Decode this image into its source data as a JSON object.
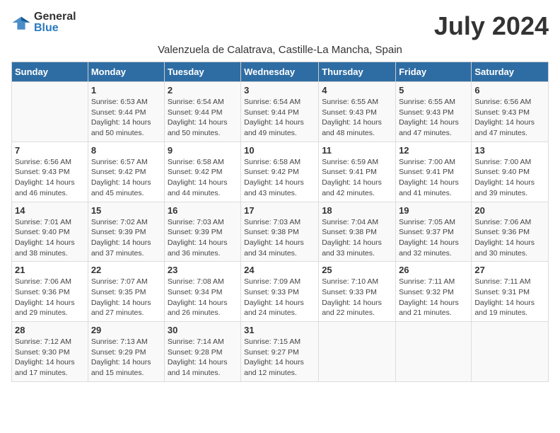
{
  "header": {
    "logo_general": "General",
    "logo_blue": "Blue",
    "month_year": "July 2024",
    "location": "Valenzuela de Calatrava, Castille-La Mancha, Spain"
  },
  "columns": [
    "Sunday",
    "Monday",
    "Tuesday",
    "Wednesday",
    "Thursday",
    "Friday",
    "Saturday"
  ],
  "weeks": [
    [
      {
        "num": "",
        "detail": ""
      },
      {
        "num": "1",
        "detail": "Sunrise: 6:53 AM\nSunset: 9:44 PM\nDaylight: 14 hours\nand 50 minutes."
      },
      {
        "num": "2",
        "detail": "Sunrise: 6:54 AM\nSunset: 9:44 PM\nDaylight: 14 hours\nand 50 minutes."
      },
      {
        "num": "3",
        "detail": "Sunrise: 6:54 AM\nSunset: 9:44 PM\nDaylight: 14 hours\nand 49 minutes."
      },
      {
        "num": "4",
        "detail": "Sunrise: 6:55 AM\nSunset: 9:43 PM\nDaylight: 14 hours\nand 48 minutes."
      },
      {
        "num": "5",
        "detail": "Sunrise: 6:55 AM\nSunset: 9:43 PM\nDaylight: 14 hours\nand 47 minutes."
      },
      {
        "num": "6",
        "detail": "Sunrise: 6:56 AM\nSunset: 9:43 PM\nDaylight: 14 hours\nand 47 minutes."
      }
    ],
    [
      {
        "num": "7",
        "detail": "Sunrise: 6:56 AM\nSunset: 9:43 PM\nDaylight: 14 hours\nand 46 minutes."
      },
      {
        "num": "8",
        "detail": "Sunrise: 6:57 AM\nSunset: 9:42 PM\nDaylight: 14 hours\nand 45 minutes."
      },
      {
        "num": "9",
        "detail": "Sunrise: 6:58 AM\nSunset: 9:42 PM\nDaylight: 14 hours\nand 44 minutes."
      },
      {
        "num": "10",
        "detail": "Sunrise: 6:58 AM\nSunset: 9:42 PM\nDaylight: 14 hours\nand 43 minutes."
      },
      {
        "num": "11",
        "detail": "Sunrise: 6:59 AM\nSunset: 9:41 PM\nDaylight: 14 hours\nand 42 minutes."
      },
      {
        "num": "12",
        "detail": "Sunrise: 7:00 AM\nSunset: 9:41 PM\nDaylight: 14 hours\nand 41 minutes."
      },
      {
        "num": "13",
        "detail": "Sunrise: 7:00 AM\nSunset: 9:40 PM\nDaylight: 14 hours\nand 39 minutes."
      }
    ],
    [
      {
        "num": "14",
        "detail": "Sunrise: 7:01 AM\nSunset: 9:40 PM\nDaylight: 14 hours\nand 38 minutes."
      },
      {
        "num": "15",
        "detail": "Sunrise: 7:02 AM\nSunset: 9:39 PM\nDaylight: 14 hours\nand 37 minutes."
      },
      {
        "num": "16",
        "detail": "Sunrise: 7:03 AM\nSunset: 9:39 PM\nDaylight: 14 hours\nand 36 minutes."
      },
      {
        "num": "17",
        "detail": "Sunrise: 7:03 AM\nSunset: 9:38 PM\nDaylight: 14 hours\nand 34 minutes."
      },
      {
        "num": "18",
        "detail": "Sunrise: 7:04 AM\nSunset: 9:38 PM\nDaylight: 14 hours\nand 33 minutes."
      },
      {
        "num": "19",
        "detail": "Sunrise: 7:05 AM\nSunset: 9:37 PM\nDaylight: 14 hours\nand 32 minutes."
      },
      {
        "num": "20",
        "detail": "Sunrise: 7:06 AM\nSunset: 9:36 PM\nDaylight: 14 hours\nand 30 minutes."
      }
    ],
    [
      {
        "num": "21",
        "detail": "Sunrise: 7:06 AM\nSunset: 9:36 PM\nDaylight: 14 hours\nand 29 minutes."
      },
      {
        "num": "22",
        "detail": "Sunrise: 7:07 AM\nSunset: 9:35 PM\nDaylight: 14 hours\nand 27 minutes."
      },
      {
        "num": "23",
        "detail": "Sunrise: 7:08 AM\nSunset: 9:34 PM\nDaylight: 14 hours\nand 26 minutes."
      },
      {
        "num": "24",
        "detail": "Sunrise: 7:09 AM\nSunset: 9:33 PM\nDaylight: 14 hours\nand 24 minutes."
      },
      {
        "num": "25",
        "detail": "Sunrise: 7:10 AM\nSunset: 9:33 PM\nDaylight: 14 hours\nand 22 minutes."
      },
      {
        "num": "26",
        "detail": "Sunrise: 7:11 AM\nSunset: 9:32 PM\nDaylight: 14 hours\nand 21 minutes."
      },
      {
        "num": "27",
        "detail": "Sunrise: 7:11 AM\nSunset: 9:31 PM\nDaylight: 14 hours\nand 19 minutes."
      }
    ],
    [
      {
        "num": "28",
        "detail": "Sunrise: 7:12 AM\nSunset: 9:30 PM\nDaylight: 14 hours\nand 17 minutes."
      },
      {
        "num": "29",
        "detail": "Sunrise: 7:13 AM\nSunset: 9:29 PM\nDaylight: 14 hours\nand 15 minutes."
      },
      {
        "num": "30",
        "detail": "Sunrise: 7:14 AM\nSunset: 9:28 PM\nDaylight: 14 hours\nand 14 minutes."
      },
      {
        "num": "31",
        "detail": "Sunrise: 7:15 AM\nSunset: 9:27 PM\nDaylight: 14 hours\nand 12 minutes."
      },
      {
        "num": "",
        "detail": ""
      },
      {
        "num": "",
        "detail": ""
      },
      {
        "num": "",
        "detail": ""
      }
    ]
  ]
}
